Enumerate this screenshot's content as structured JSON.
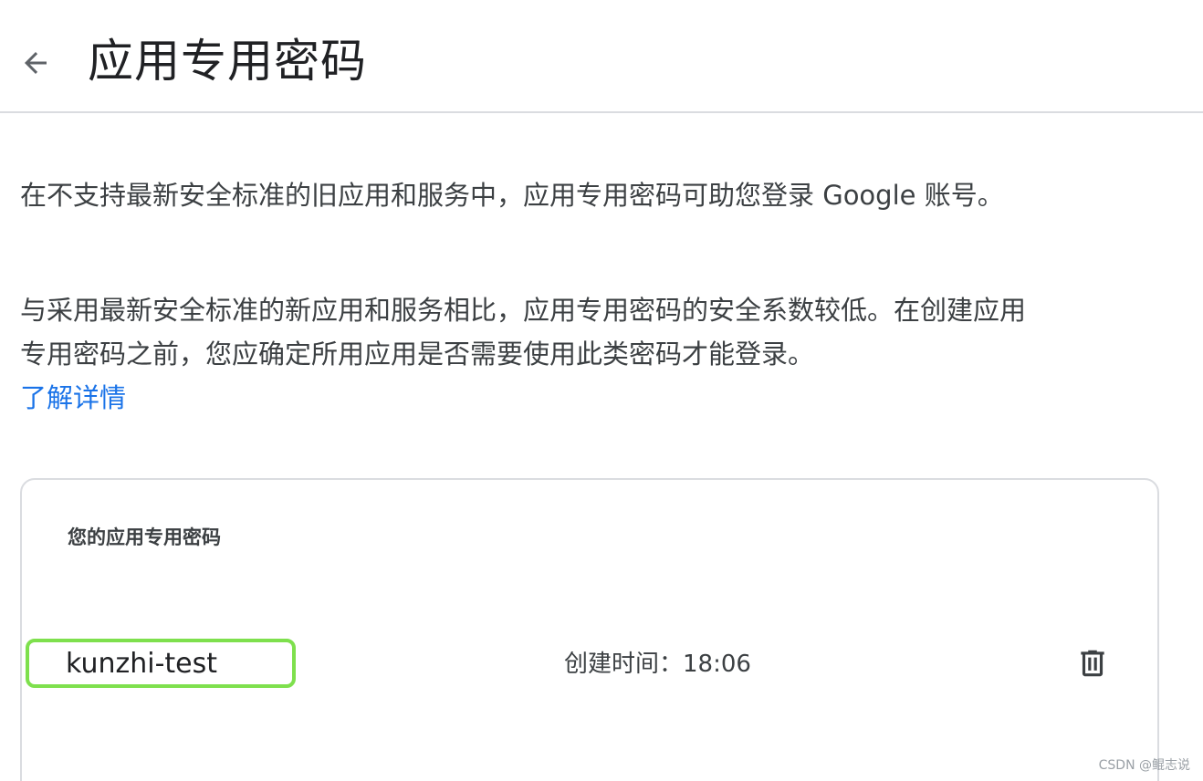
{
  "header": {
    "back_icon": "arrow-back-icon",
    "title": "应用专用密码"
  },
  "intro": {
    "paragraph1": "在不支持最新安全标准的旧应用和服务中，应用专用密码可助您登录 Google 账号。",
    "paragraph2": "与采用最新安全标准的新应用和服务相比，应用专用密码的安全系数较低。在创建应用专用密码之前，您应确定所用应用是否需要使用此类密码才能登录。",
    "learn_more": "了解详情"
  },
  "passwords_card": {
    "title": "您的应用专用密码",
    "items": [
      {
        "name": "kunzhi-test",
        "created": "创建时间：18:06",
        "delete_icon": "trash-icon"
      }
    ]
  },
  "watermark": "CSDN @鲲志说",
  "colors": {
    "link": "#1a73e8",
    "highlight": "#7ee04d",
    "divider": "#dadce0"
  }
}
